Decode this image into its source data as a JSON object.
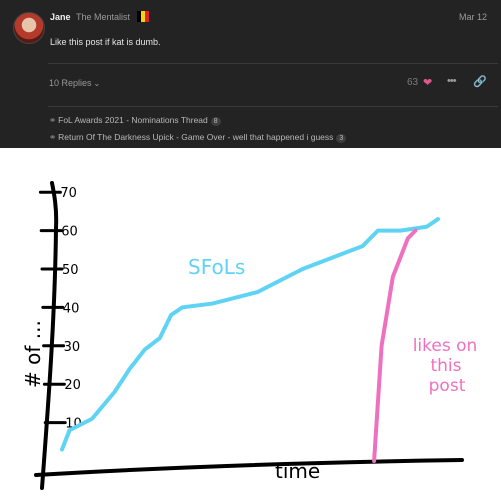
{
  "post": {
    "username": "Jane",
    "user_title": "The Mentalist",
    "date": "Mar 12",
    "body": "Like this post if kat is dumb.",
    "flag_colors": [
      "#000000",
      "#f5d20a",
      "#e1202a"
    ]
  },
  "footer": {
    "replies_label": "10 Replies",
    "like_count": "63",
    "heart_icon": "heart-icon",
    "more_icon": "ellipsis-icon",
    "link_icon": "link-icon"
  },
  "related_topics": [
    {
      "title": "FoL Awards 2021 - Nominations Thread",
      "count": "8"
    },
    {
      "title": "Return Of The Darkness Upick - Game Over - well that happened i guess",
      "count": "3"
    }
  ],
  "chart_data": {
    "type": "line",
    "xlabel": "time",
    "ylabel": "# of ...",
    "y_ticks": [
      "10",
      "20",
      "30",
      "40",
      "50",
      "60",
      "70"
    ],
    "ylim": [
      0,
      75
    ],
    "series": [
      {
        "name": "SFoLs",
        "color": "#5fd3f3",
        "points": [
          [
            0,
            3
          ],
          [
            2,
            8
          ],
          [
            8,
            11
          ],
          [
            14,
            18
          ],
          [
            18,
            24
          ],
          [
            22,
            29
          ],
          [
            26,
            32
          ],
          [
            29,
            38
          ],
          [
            32,
            40
          ],
          [
            40,
            41
          ],
          [
            52,
            44
          ],
          [
            58,
            47
          ],
          [
            64,
            50
          ],
          [
            72,
            53
          ],
          [
            80,
            56
          ],
          [
            84,
            60
          ],
          [
            90,
            60
          ],
          [
            97,
            61
          ],
          [
            100,
            63
          ]
        ]
      },
      {
        "name": "likes on this post",
        "color": "#f070c0",
        "points": [
          [
            83,
            0
          ],
          [
            85,
            30
          ],
          [
            88,
            48
          ],
          [
            92,
            58
          ],
          [
            94,
            60
          ]
        ]
      }
    ]
  }
}
